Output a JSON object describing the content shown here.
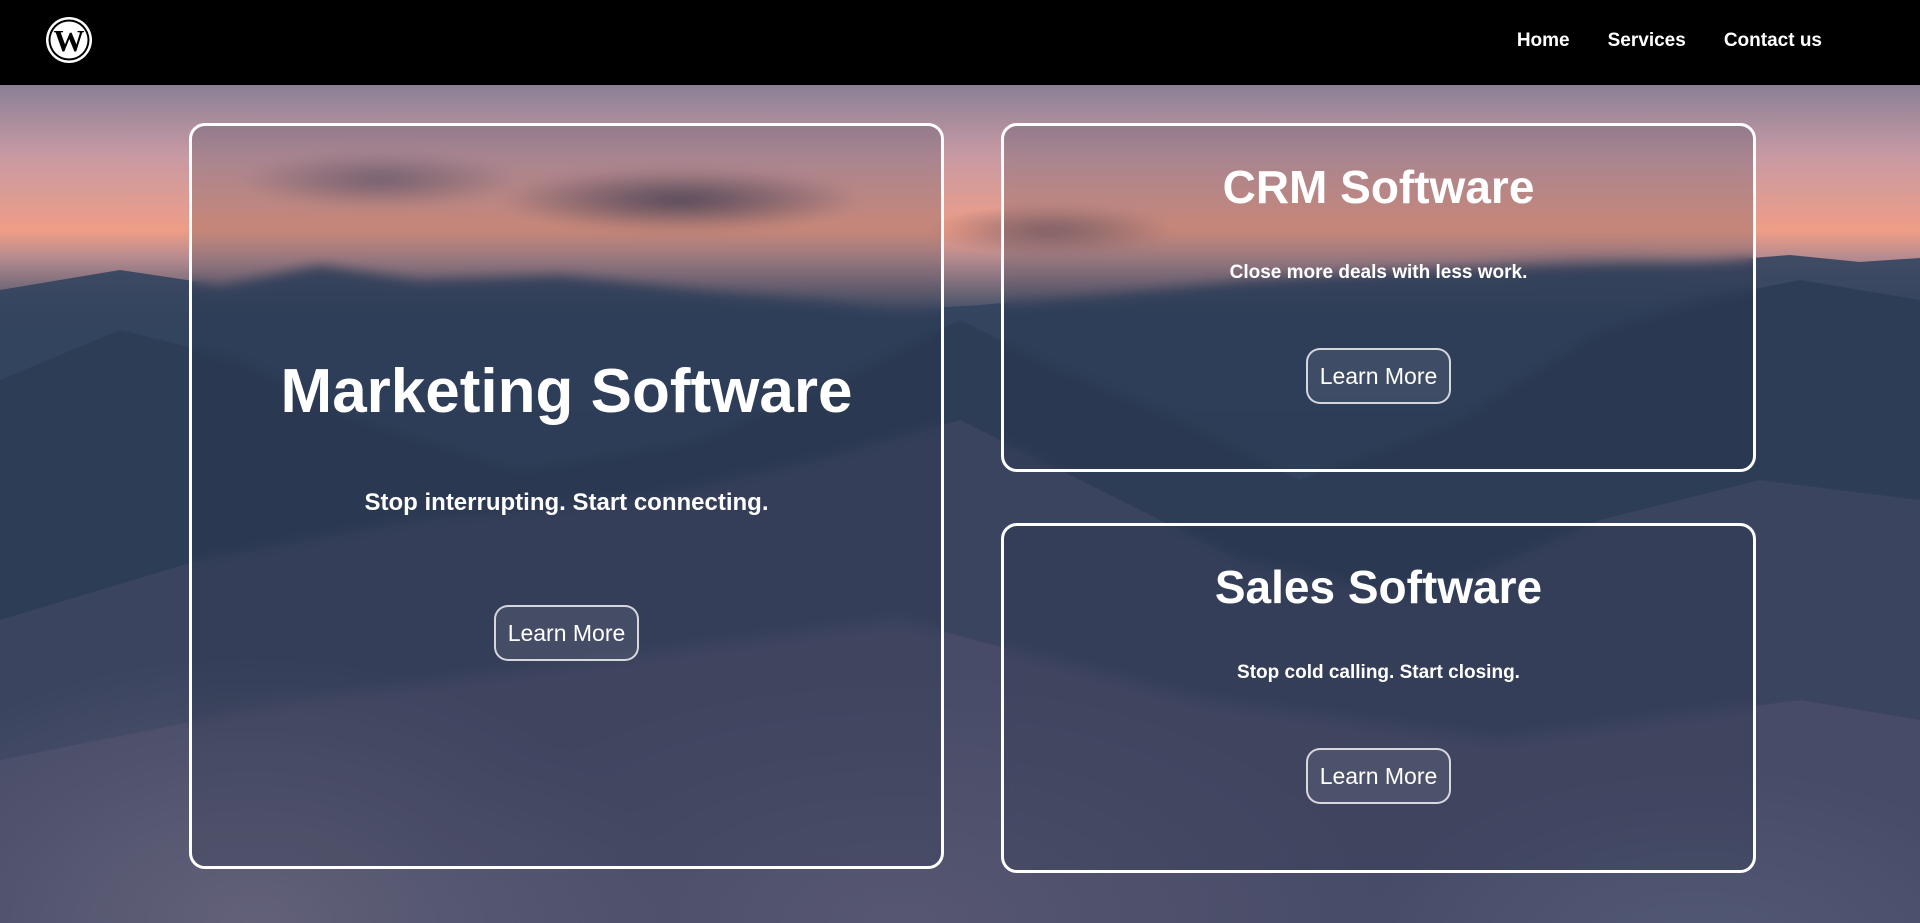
{
  "nav": {
    "items": [
      {
        "label": "Home"
      },
      {
        "label": "Services"
      },
      {
        "label": "Contact us"
      }
    ]
  },
  "cards": {
    "marketing": {
      "title": "Marketing Software",
      "tagline": "Stop interrupting. Start connecting.",
      "button_label": "Learn More"
    },
    "crm": {
      "title": "CRM Software",
      "tagline": "Close more deals with less work.",
      "button_label": "Learn More"
    },
    "sales": {
      "title": "Sales Software",
      "tagline": "Stop cold calling. Start closing.",
      "button_label": "Learn More"
    }
  },
  "colors": {
    "navbar": "#000000",
    "card_border": "#ffffff",
    "text": "#ffffff"
  },
  "icons": {
    "logo": "wordpress-logo-icon"
  }
}
